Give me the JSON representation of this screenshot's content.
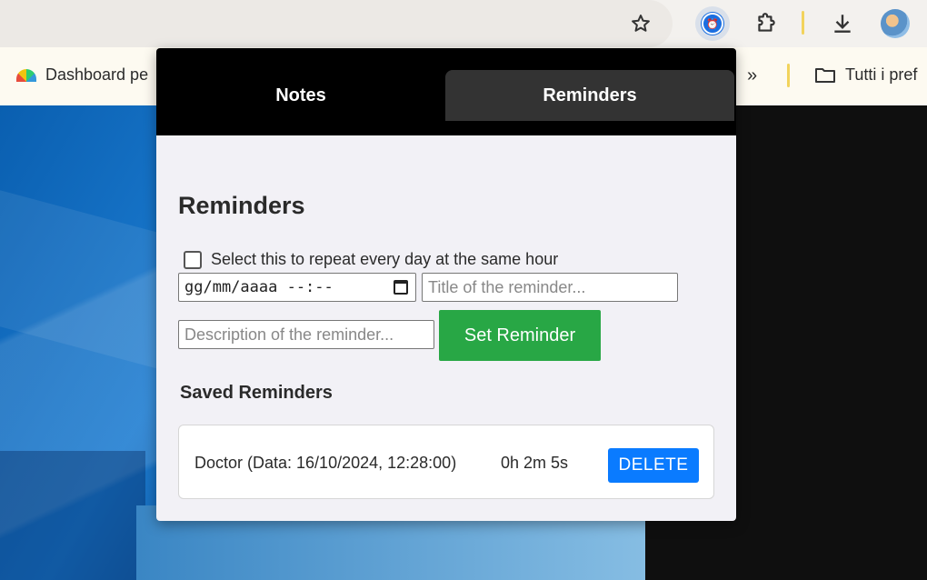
{
  "browser": {
    "bookmarks": {
      "first_label": "Dashboard pe",
      "overflow_label": "»",
      "folder_label": "Tutti i pref"
    },
    "toolbar": {
      "extension_badge": "⏰"
    }
  },
  "popup": {
    "tabs": [
      {
        "label": "Notes",
        "active": false
      },
      {
        "label": "Reminders",
        "active": true
      }
    ],
    "title": "Reminders",
    "repeat_label": "Select this to repeat every day at the same hour",
    "date_placeholder": "gg/mm/aaaa --:--",
    "title_placeholder": "Title of the reminder...",
    "description_placeholder": "Description of the reminder...",
    "set_button": "Set Reminder",
    "saved_heading": "Saved Reminders",
    "reminders": [
      {
        "text": "Doctor (Data: 16/10/2024, 12:28:00)",
        "countdown": "0h 2m 5s",
        "delete_label": "DELETE"
      }
    ]
  },
  "colors": {
    "tab_active_bg": "#333333",
    "set_button_bg": "#28a745",
    "delete_button_bg": "#0a7bff"
  }
}
